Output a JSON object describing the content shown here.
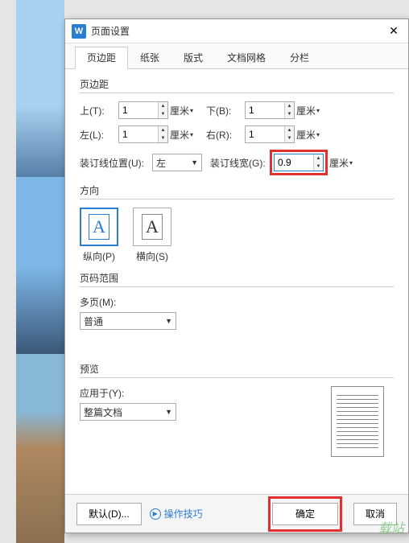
{
  "titlebar": {
    "app_glyph": "W",
    "title": "页面设置"
  },
  "tabs": [
    "页边距",
    "纸张",
    "版式",
    "文档网格",
    "分栏"
  ],
  "margins": {
    "legend": "页边距",
    "top_label": "上(T):",
    "top_value": "1",
    "top_unit": "厘米",
    "bottom_label": "下(B):",
    "bottom_value": "1",
    "bottom_unit": "厘米",
    "left_label": "左(L):",
    "left_value": "1",
    "left_unit": "厘米",
    "right_label": "右(R):",
    "right_value": "1",
    "right_unit": "厘米",
    "gutter_pos_label": "装订线位置(U):",
    "gutter_pos_value": "左",
    "gutter_width_label": "装订线宽(G):",
    "gutter_width_value": "0.9",
    "gutter_width_unit": "厘米"
  },
  "orientation": {
    "legend": "方向",
    "portrait": "纵向(P)",
    "landscape": "横向(S)",
    "glyph": "A"
  },
  "range": {
    "legend": "页码范围",
    "multi_label": "多页(M):",
    "multi_value": "普通"
  },
  "preview": {
    "legend": "预览",
    "apply_label": "应用于(Y):",
    "apply_value": "整篇文档"
  },
  "footer": {
    "default": "默认(D)...",
    "tips": "操作技巧",
    "ok": "确定",
    "cancel": "取消"
  },
  "watermark": "载站"
}
